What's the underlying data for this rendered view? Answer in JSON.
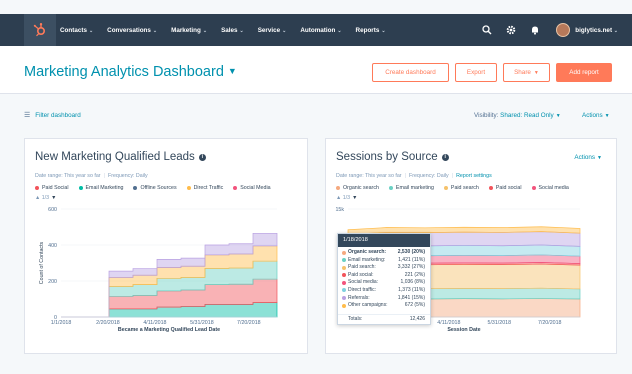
{
  "nav": {
    "items": [
      "Contacts",
      "Conversations",
      "Marketing",
      "Sales",
      "Service",
      "Automation",
      "Reports"
    ],
    "account": "biglytics.net",
    "brand_color": "#ff7a59",
    "bar_color": "#2d3e50"
  },
  "header": {
    "title": "Marketing Analytics Dashboard",
    "buttons": {
      "create": "Create dashboard",
      "export": "Export",
      "share": "Share",
      "add_report": "Add report"
    }
  },
  "filterbar": {
    "filter_label": "Filter dashboard",
    "visibility_label": "Visibility:",
    "visibility_value": "Shared: Read Only",
    "actions_label": "Actions"
  },
  "card1": {
    "title": "New Marketing Qualified Leads",
    "date_range": "Date range: This year so far",
    "frequency": "Frequency: Daily",
    "pager": "1/3",
    "legend": [
      {
        "name": "Paid Social",
        "color": "#f2545b"
      },
      {
        "name": "Email Marketing",
        "color": "#00bda5"
      },
      {
        "name": "Offline Sources",
        "color": "#516f90"
      },
      {
        "name": "Direct Traffic",
        "color": "#ffbc4b"
      },
      {
        "name": "Social Media",
        "color": "#f2547d"
      }
    ]
  },
  "card2": {
    "title": "Sessions by Source",
    "actions": "Actions",
    "date_range": "Date range: This year so far",
    "frequency": "Frequency: Daily",
    "settings_link": "Report settings",
    "pager": "1/3",
    "legend": [
      {
        "name": "Organic search",
        "color": "#f5a97f"
      },
      {
        "name": "Email marketing",
        "color": "#6bd1c4"
      },
      {
        "name": "Paid search",
        "color": "#f5c26b"
      },
      {
        "name": "Paid social",
        "color": "#f2545b"
      },
      {
        "name": "Social media",
        "color": "#f2547d"
      }
    ],
    "tooltip": {
      "date": "1/18/2018",
      "rows": [
        {
          "name": "Organic search:",
          "value": "2,530 (20%)",
          "color": "#f5a97f",
          "bold": true
        },
        {
          "name": "Email marketing:",
          "value": "1,421 (11%)",
          "color": "#6bd1c4",
          "bold": false
        },
        {
          "name": "Paid search:",
          "value": "3,332 (27%)",
          "color": "#f5c26b",
          "bold": false
        },
        {
          "name": "Paid social:",
          "value": "221 (2%)",
          "color": "#f2545b",
          "bold": false
        },
        {
          "name": "Social media:",
          "value": "1,036 (8%)",
          "color": "#f2547d",
          "bold": false
        },
        {
          "name": "Direct traffic:",
          "value": "1,373 (11%)",
          "color": "#7fd1e0",
          "bold": false
        },
        {
          "name": "Referrals:",
          "value": "1,841 (15%)",
          "color": "#b9a1e2",
          "bold": false
        },
        {
          "name": "Other campaigns:",
          "value": "672 (5%)",
          "color": "#ffbc4b",
          "bold": false
        }
      ],
      "total_label": "Totals:",
      "total_value": "12,426"
    }
  },
  "chart_data": [
    {
      "type": "area",
      "title": "New Marketing Qualified Leads",
      "xlabel": "Became a Marketing Qualified Lead Date",
      "ylabel": "Count of Contacts",
      "x_ticks": [
        "1/1/2018",
        "2/20/2018",
        "4/11/2018",
        "5/31/2018",
        "7/20/2018"
      ],
      "y_ticks": [
        "0",
        "200",
        "400",
        "600"
      ],
      "ylim": [
        0,
        600
      ],
      "stacked": true,
      "x": [
        "1/1/2018",
        "2/10/2018",
        "2/20/2018",
        "3/20/2018",
        "4/11/2018",
        "5/1/2018",
        "5/31/2018",
        "6/20/2018",
        "7/20/2018",
        "8/10/2018"
      ],
      "series": [
        {
          "name": "Paid Social",
          "values": [
            0,
            0,
            45,
            45,
            55,
            58,
            70,
            70,
            80,
            80
          ]
        },
        {
          "name": "Email Marketing",
          "values": [
            0,
            0,
            70,
            75,
            90,
            92,
            110,
            112,
            130,
            130
          ]
        },
        {
          "name": "Offline Sources",
          "values": [
            0,
            0,
            55,
            60,
            70,
            70,
            90,
            90,
            100,
            100
          ]
        },
        {
          "name": "Direct Traffic",
          "values": [
            0,
            0,
            50,
            52,
            60,
            62,
            75,
            78,
            85,
            85
          ]
        },
        {
          "name": "Social Media",
          "values": [
            0,
            0,
            35,
            37,
            45,
            45,
            55,
            57,
            70,
            70
          ]
        }
      ]
    },
    {
      "type": "area",
      "title": "Sessions by Source",
      "xlabel": "Session Date",
      "ylabel": "",
      "x_ticks": [
        "1/1/2018",
        "2/20/2018",
        "4/11/2018",
        "5/31/2018",
        "7/20/2018"
      ],
      "y_ticks": [
        "15k"
      ],
      "ylim": [
        0,
        15000
      ],
      "stacked": true,
      "x": [
        "1/1/2018",
        "1/18/2018",
        "2/20/2018",
        "4/11/2018",
        "5/31/2018",
        "7/20/2018",
        "8/10/2018"
      ],
      "series": [
        {
          "name": "Organic search",
          "values": [
            2400,
            2530,
            2500,
            2550,
            2520,
            2560,
            2500
          ]
        },
        {
          "name": "Email marketing",
          "values": [
            1400,
            1421,
            1430,
            1410,
            1420,
            1440,
            1400
          ]
        },
        {
          "name": "Paid search",
          "values": [
            3300,
            3332,
            3320,
            3340,
            3330,
            3350,
            3300
          ]
        },
        {
          "name": "Paid social",
          "values": [
            220,
            221,
            225,
            222,
            220,
            224,
            220
          ]
        },
        {
          "name": "Social media",
          "values": [
            1000,
            1036,
            1030,
            1040,
            1035,
            1045,
            1030
          ]
        },
        {
          "name": "Direct traffic",
          "values": [
            1350,
            1373,
            1370,
            1380,
            1375,
            1385,
            1360
          ]
        },
        {
          "name": "Referrals",
          "values": [
            1800,
            1841,
            1840,
            1850,
            1845,
            1855,
            1830
          ]
        },
        {
          "name": "Other campaigns",
          "values": [
            650,
            672,
            670,
            675,
            672,
            680,
            660
          ]
        }
      ]
    }
  ]
}
